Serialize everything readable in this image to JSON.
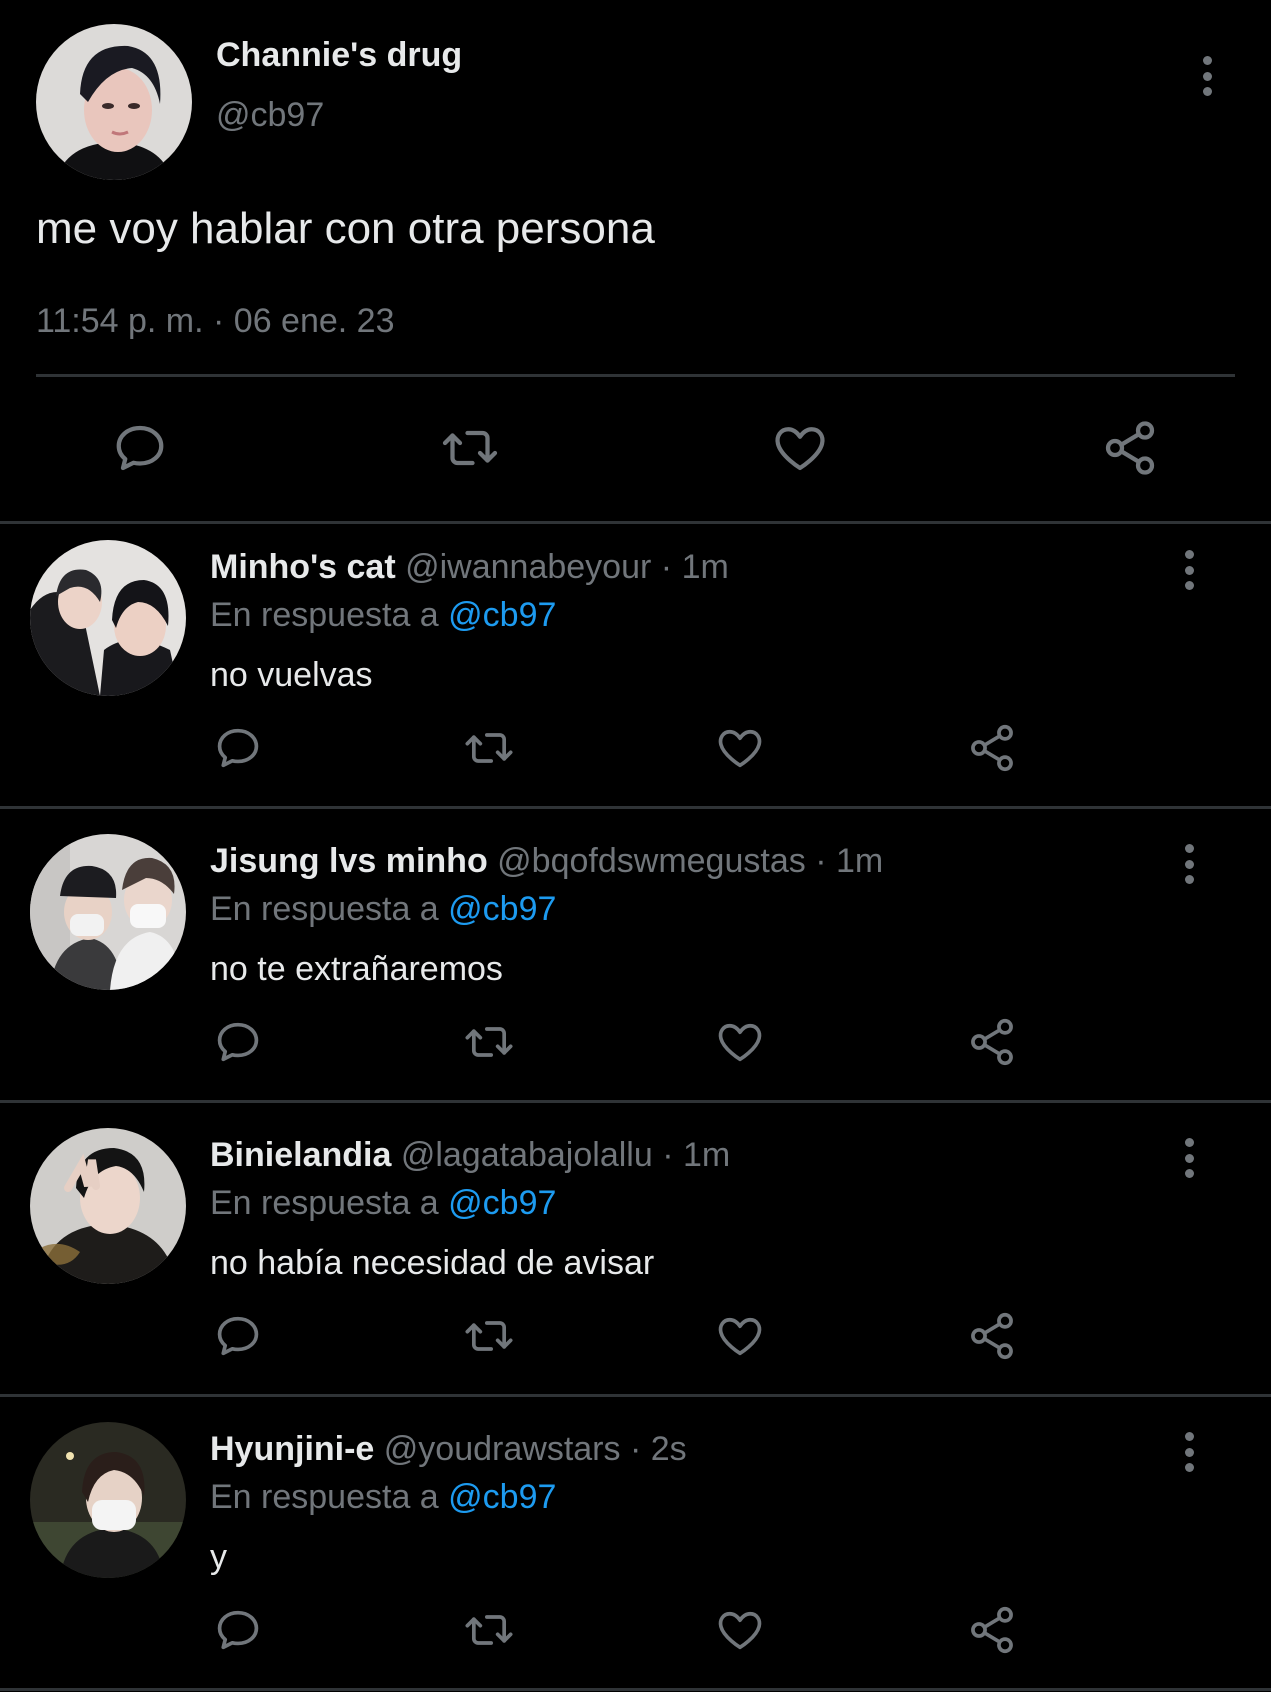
{
  "main_tweet": {
    "author_name": "Channie's drug",
    "author_handle": "@cb97",
    "text": "me voy hablar con otra persona",
    "timestamp": "11:54 p. m. · 06 ene. 23",
    "avatar_colors": {
      "skin": "#e9c6bd",
      "hair": "#1a1a22",
      "bg": "#dcdad8",
      "shirt": "#101012"
    }
  },
  "replies": [
    {
      "name": "Minho's cat",
      "handle": "@iwannabeyour",
      "dot": "·",
      "time": "1m",
      "in_reply_prefix": "En respuesta a",
      "mention": "@cb97",
      "text": "no vuelvas"
    },
    {
      "name": "Jisung lvs minho",
      "handle": "@bqofdswmegustas",
      "dot": "·",
      "time": "1m",
      "in_reply_prefix": "En respuesta a",
      "mention": "@cb97",
      "text": "no te extrañaremos"
    },
    {
      "name": "Binielandia",
      "handle": "@lagatabajolallu",
      "dot": "·",
      "time": "1m",
      "in_reply_prefix": "En respuesta a",
      "mention": "@cb97",
      "text": "no había necesidad de avisar"
    },
    {
      "name": "Hyunjini-e",
      "handle": "@youdrawstars",
      "dot": "·",
      "time": "2s",
      "in_reply_prefix": "En respuesta a",
      "mention": "@cb97",
      "text": "y"
    }
  ],
  "icons": {
    "reply": "speech-bubble-icon",
    "retweet": "retweet-icon",
    "like": "heart-icon",
    "share": "share-icon",
    "more": "vertical-dots-icon"
  },
  "colors": {
    "background": "#000000",
    "text_primary": "#e7e9ea",
    "text_secondary": "#71767b",
    "accent": "#1d9bf0",
    "divider": "#2f3336"
  }
}
